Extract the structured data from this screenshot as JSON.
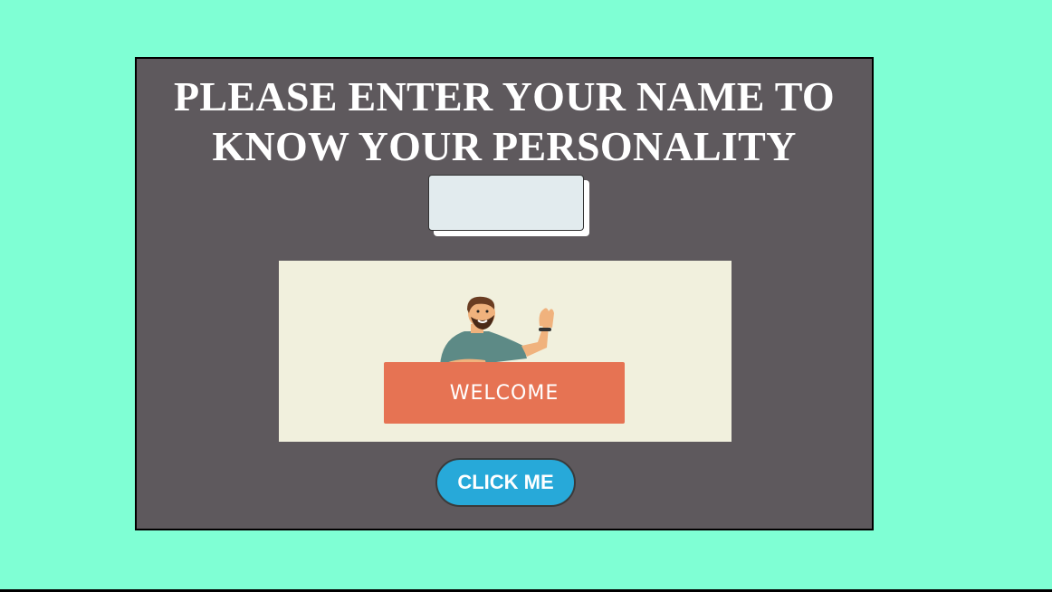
{
  "form": {
    "title_line1": "PLEASE ENTER YOUR NAME TO",
    "title_line2": "KNOW YOUR PERSONALITY",
    "name_value": "",
    "name_placeholder": "",
    "button_label": "CLICK ME"
  },
  "image": {
    "banner_text": "WELCOME"
  },
  "colors": {
    "page_background": "#7fffd4",
    "card_background": "#5e595d",
    "button_background": "#27a9d9",
    "banner": "#e67353",
    "image_background": "#f1f0dd"
  }
}
